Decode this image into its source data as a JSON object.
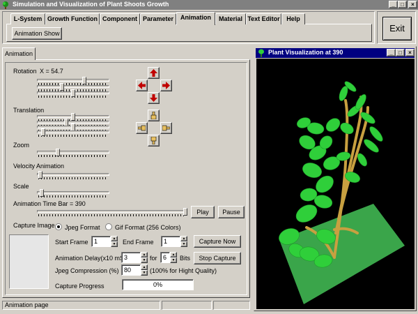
{
  "main_window": {
    "title": "Simulation and Visualization of Plant Shoots Growth",
    "controls": {
      "minimize": "_",
      "maximize": "□",
      "close": "×"
    }
  },
  "tabs": [
    {
      "label": "L-System"
    },
    {
      "label": "Growth Function"
    },
    {
      "label": "Component"
    },
    {
      "label": "Parameter"
    },
    {
      "label": "Animation"
    },
    {
      "label": "Material"
    },
    {
      "label": "Text Editor"
    },
    {
      "label": "Help"
    }
  ],
  "toolbar": {
    "animation_show": "Animation Show",
    "exit": "Exit"
  },
  "panel": {
    "tab_label": "Animation",
    "rotation": {
      "label": "Rotation",
      "value_text": "X = 54.7",
      "levels": [
        0.66,
        0.34,
        0.5
      ]
    },
    "translation": {
      "label": "Translation",
      "levels": [
        0.5,
        0.4,
        0.5,
        0.06
      ]
    },
    "zoom": {
      "label": "Zoom",
      "level": 0.28
    },
    "velocity": {
      "label": "Velocity Animation",
      "level": 0.02
    },
    "scale": {
      "label": "Scale",
      "level": 0.04
    },
    "time_bar": {
      "label": "Animation Time Bar",
      "value_text": "= 390",
      "level": 1.0
    },
    "play": "Play",
    "pause": "Pause",
    "capture": {
      "label": "Capture Image",
      "jpeg_label": "Jpeg Format",
      "gif_label": "Gif Format (256 Colors)",
      "selected": "jpeg",
      "start_frame_label": "Start Frame",
      "start_frame": "1",
      "end_frame_label": "End Frame",
      "end_frame": "1",
      "capture_now": "Capture Now",
      "delay_label": "Animation Delay(x10 mS)",
      "delay": "3",
      "for_label": "for",
      "bits": "6",
      "bits_label": "Bits",
      "stop_capture": "Stop Capture",
      "jpeg_compression_label": "Jpeg Compression (%)",
      "jpeg_compression": "80",
      "quality_note": "(100% for Hight Quality)",
      "progress_label": "Capture Progress",
      "progress_text": "0%",
      "progress": 0
    }
  },
  "viz_window": {
    "title": "Plant Visualization at 390",
    "controls": {
      "minimize": "_",
      "maximize": "□",
      "close": "×"
    },
    "colors": {
      "background": "#000000",
      "ground": "#3aa54a",
      "leaf": "#2fcf3a",
      "stem": "#c8a040"
    }
  },
  "status_bar": {
    "text": "Animation page"
  },
  "icons": [
    "app-tree-icon",
    "arrow-up-icon",
    "arrow-down-icon",
    "arrow-left-icon",
    "arrow-right-icon",
    "hand-up-icon",
    "hand-down-icon",
    "hand-left-icon",
    "hand-right-icon"
  ]
}
